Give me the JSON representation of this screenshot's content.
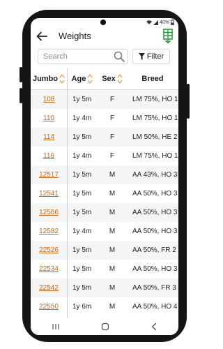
{
  "status": {
    "battery": "40%"
  },
  "appbar": {
    "title": "Weights",
    "back_icon": "arrow-left-icon",
    "menu_icon": "spreadsheet-icon"
  },
  "search": {
    "placeholder": "Search",
    "filter_label": "Filter"
  },
  "table": {
    "columns": [
      "Jumbo",
      "Age",
      "Sex",
      "Breed"
    ],
    "rows": [
      {
        "jumbo": "108",
        "age": "1y 5m",
        "sex": "F",
        "breed": "LM 75%, HO 1"
      },
      {
        "jumbo": "110",
        "age": "1y 4m",
        "sex": "F",
        "breed": "LM 75%, HO 1"
      },
      {
        "jumbo": "114",
        "age": "1y 5m",
        "sex": "F",
        "breed": "LM 50%, HE 2"
      },
      {
        "jumbo": "116",
        "age": "1y 4m",
        "sex": "F",
        "breed": "LM 75%, HO 1"
      },
      {
        "jumbo": "12517",
        "age": "1y 5m",
        "sex": "M",
        "breed": "AA 43%, HO 3"
      },
      {
        "jumbo": "12541",
        "age": "1y 5m",
        "sex": "M",
        "breed": "AA 50%, HO 3"
      },
      {
        "jumbo": "12566",
        "age": "1y 5m",
        "sex": "M",
        "breed": "AA 50%, HO 3"
      },
      {
        "jumbo": "12582",
        "age": "1y 4m",
        "sex": "M",
        "breed": "AA 50%, HO 3"
      },
      {
        "jumbo": "22526",
        "age": "1y 5m",
        "sex": "M",
        "breed": "AA 50%, FR 2"
      },
      {
        "jumbo": "22534",
        "age": "1y 5m",
        "sex": "M",
        "breed": "AA 50%, HO 3"
      },
      {
        "jumbo": "22542",
        "age": "1y 5m",
        "sex": "M",
        "breed": "AA 50%, FR 3"
      },
      {
        "jumbo": "22550",
        "age": "1y 6m",
        "sex": "M",
        "breed": "AA 50%, HO 4"
      }
    ]
  },
  "colors": {
    "accent": "#c8691d",
    "sort_arrows": "#e89a4a",
    "menu_icon": "#2e9b3e"
  }
}
